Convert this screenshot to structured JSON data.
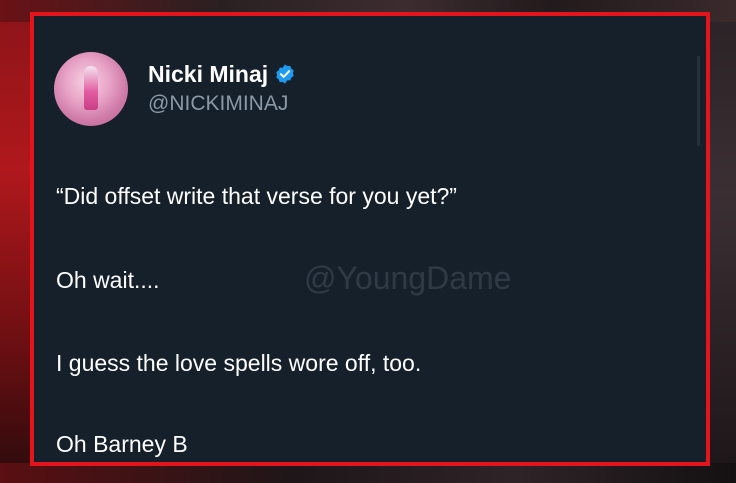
{
  "tweet": {
    "display_name": "Nicki Minaj",
    "handle": "@NICKIMINAJ",
    "verified_icon": "verified-badge-icon",
    "lines": [
      "“Did offset write that verse for you yet?”",
      "Oh wait....",
      "I guess the love spells wore off, too.",
      "Oh Barney B"
    ]
  },
  "watermark": "@YoungDame",
  "colors": {
    "card_background": "#15202b",
    "border": "#e3141c",
    "verified": "#1d9bf0",
    "handle": "#8b98a5",
    "text": "#ffffff"
  }
}
